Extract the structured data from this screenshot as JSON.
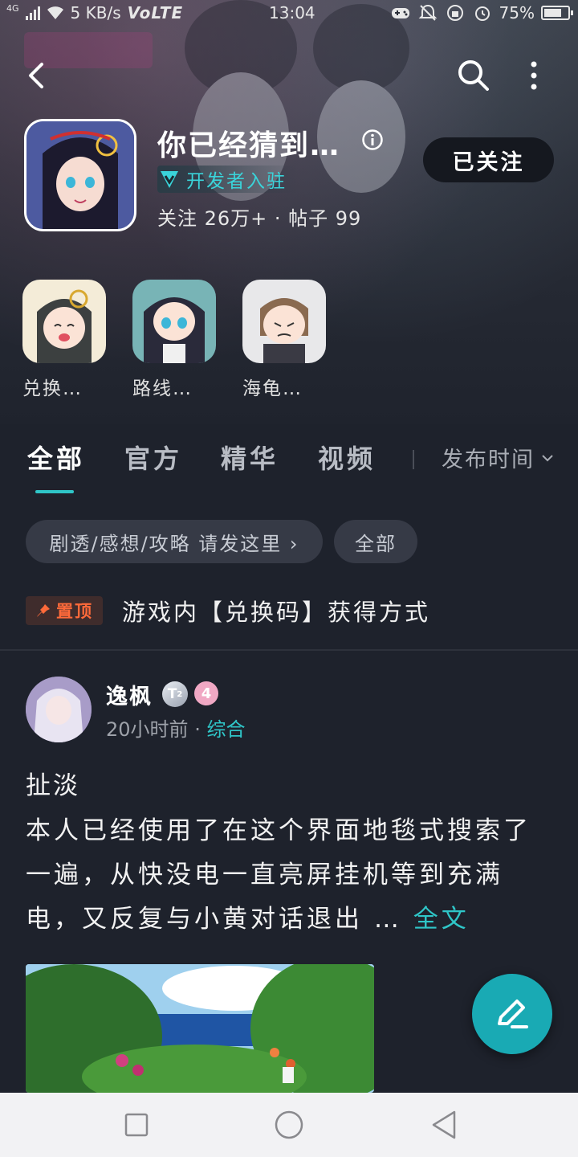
{
  "status_bar": {
    "network": "4G",
    "speed": "5 KB/s",
    "volte": "VoLTE",
    "time": "13:04",
    "battery": "75%",
    "battery_level": 0.75
  },
  "forum": {
    "title": "你已经猜到…",
    "dev_badge": "开发者入驻",
    "stats": "关注 26万+ · 帖子 99",
    "follow_label": "已关注"
  },
  "quick_links": [
    {
      "label": "兑换…"
    },
    {
      "label": "路线…"
    },
    {
      "label": "海龟…"
    }
  ],
  "tabs": [
    {
      "label": "全部"
    },
    {
      "label": "官方"
    },
    {
      "label": "精华"
    },
    {
      "label": "视频"
    }
  ],
  "sort_label": "发布时间",
  "chips": [
    {
      "label": "剧透/感想/攻略 请发这里 ›"
    },
    {
      "label": "全部"
    }
  ],
  "pinned": {
    "badge": "置顶",
    "title": "游戏内【兑换码】获得方式"
  },
  "post": {
    "author": "逸枫",
    "level_badge": "T",
    "level_sub": "2",
    "rank": "4",
    "time": "20小时前",
    "dot": "·",
    "category": "综合",
    "title": "扯淡",
    "body": "本人已经使用了在这个界面地毯式搜索了一遍，从快没电一直亮屏挂机等到充满电，又反复与小黄对话退出 … ",
    "full_text_label": "全文"
  },
  "colors": {
    "accent": "#2fc6c8",
    "pin": "#ff6a3a",
    "background": "#1e222c",
    "fab": "#19aab4"
  }
}
